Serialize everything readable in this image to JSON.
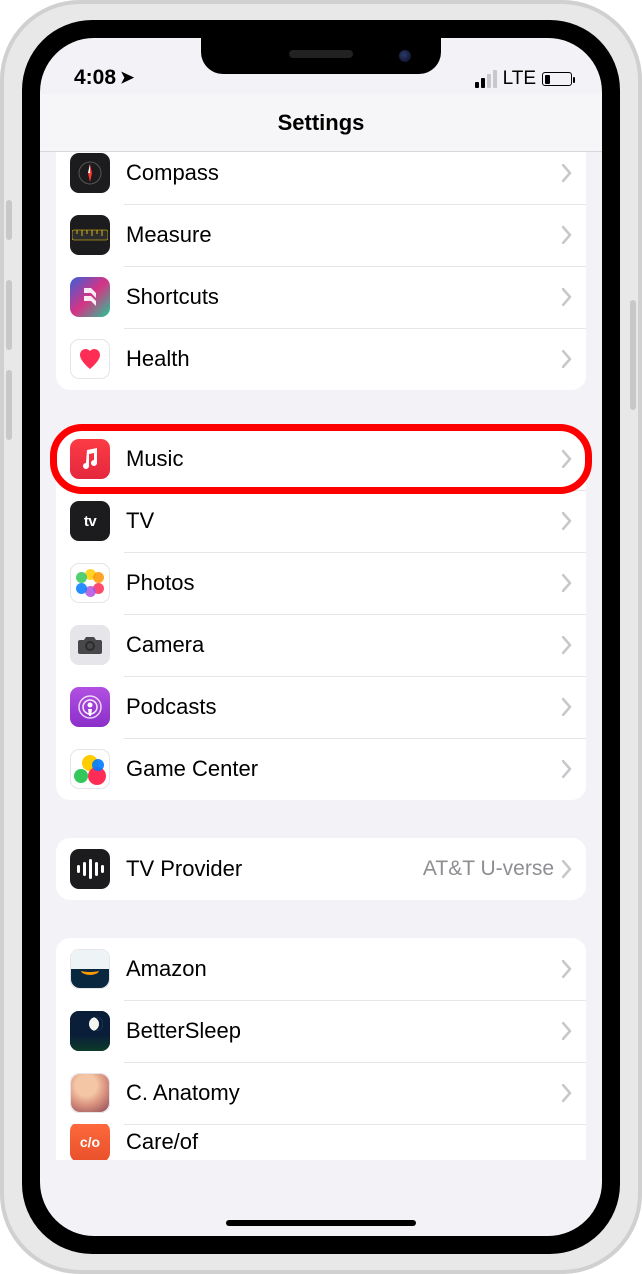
{
  "status": {
    "time": "4:08",
    "network": "LTE"
  },
  "header": {
    "title": "Settings"
  },
  "groups": [
    {
      "id": "g1",
      "rows": [
        {
          "icon": "compass",
          "label": "Compass"
        },
        {
          "icon": "measure",
          "label": "Measure"
        },
        {
          "icon": "shortcuts",
          "label": "Shortcuts"
        },
        {
          "icon": "health",
          "label": "Health"
        }
      ]
    },
    {
      "id": "g2",
      "rows": [
        {
          "icon": "music",
          "label": "Music",
          "highlighted": true
        },
        {
          "icon": "tv",
          "label": "TV"
        },
        {
          "icon": "photos",
          "label": "Photos"
        },
        {
          "icon": "camera",
          "label": "Camera"
        },
        {
          "icon": "podcasts",
          "label": "Podcasts"
        },
        {
          "icon": "gamecenter",
          "label": "Game Center"
        }
      ]
    },
    {
      "id": "g3",
      "rows": [
        {
          "icon": "tvprovider",
          "label": "TV Provider",
          "detail": "AT&T U-verse"
        }
      ]
    },
    {
      "id": "g4",
      "rows": [
        {
          "icon": "amazon",
          "label": "Amazon"
        },
        {
          "icon": "bettersleep",
          "label": "BetterSleep"
        },
        {
          "icon": "anatomy",
          "label": "C. Anatomy"
        },
        {
          "icon": "careof",
          "label": "Care/of"
        }
      ]
    }
  ]
}
